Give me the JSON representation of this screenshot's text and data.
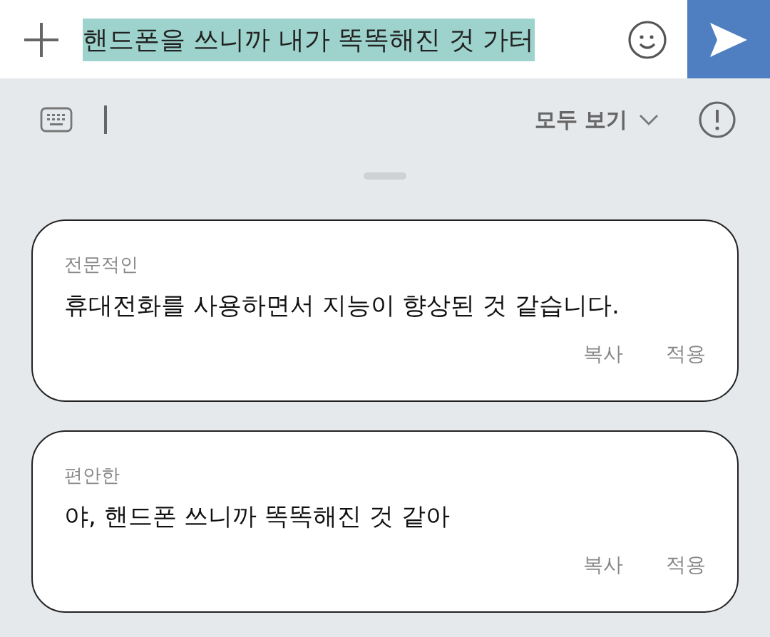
{
  "composer": {
    "value": "핸드폰을 쓰니까 내가 똑똑해진 것 가터",
    "highlighted": true
  },
  "toolbar": {
    "view_all": "모두 보기"
  },
  "suggestions": [
    {
      "tone": "전문적인",
      "text": "휴대전화를 사용하면서 지능이 향상된 것 같습니다.",
      "actions": [
        "복사",
        "적용"
      ]
    },
    {
      "tone": "편안한",
      "text": "야, 핸드폰 쓰니까 똑똑해진 것 같아",
      "actions": [
        "복사",
        "적용"
      ]
    }
  ]
}
